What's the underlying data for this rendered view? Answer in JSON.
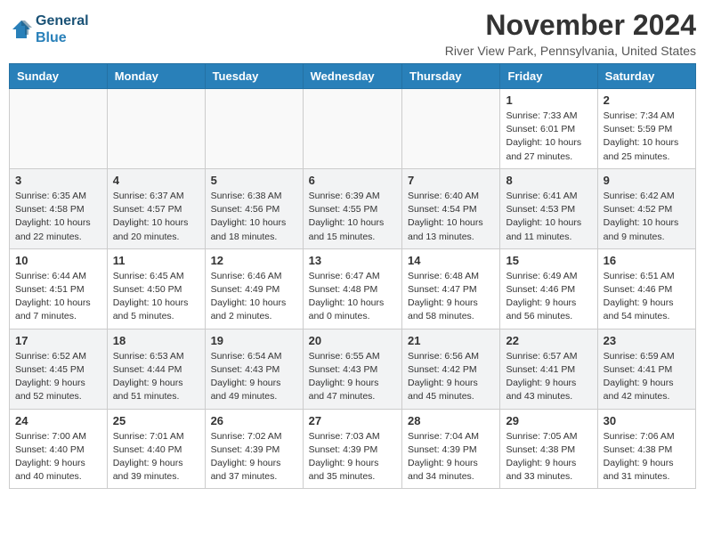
{
  "header": {
    "logo_line1": "General",
    "logo_line2": "Blue",
    "month_title": "November 2024",
    "location": "River View Park, Pennsylvania, United States"
  },
  "days_of_week": [
    "Sunday",
    "Monday",
    "Tuesday",
    "Wednesday",
    "Thursday",
    "Friday",
    "Saturday"
  ],
  "weeks": [
    [
      {
        "day": "",
        "info": ""
      },
      {
        "day": "",
        "info": ""
      },
      {
        "day": "",
        "info": ""
      },
      {
        "day": "",
        "info": ""
      },
      {
        "day": "",
        "info": ""
      },
      {
        "day": "1",
        "info": "Sunrise: 7:33 AM\nSunset: 6:01 PM\nDaylight: 10 hours and 27 minutes."
      },
      {
        "day": "2",
        "info": "Sunrise: 7:34 AM\nSunset: 5:59 PM\nDaylight: 10 hours and 25 minutes."
      }
    ],
    [
      {
        "day": "3",
        "info": "Sunrise: 6:35 AM\nSunset: 4:58 PM\nDaylight: 10 hours and 22 minutes."
      },
      {
        "day": "4",
        "info": "Sunrise: 6:37 AM\nSunset: 4:57 PM\nDaylight: 10 hours and 20 minutes."
      },
      {
        "day": "5",
        "info": "Sunrise: 6:38 AM\nSunset: 4:56 PM\nDaylight: 10 hours and 18 minutes."
      },
      {
        "day": "6",
        "info": "Sunrise: 6:39 AM\nSunset: 4:55 PM\nDaylight: 10 hours and 15 minutes."
      },
      {
        "day": "7",
        "info": "Sunrise: 6:40 AM\nSunset: 4:54 PM\nDaylight: 10 hours and 13 minutes."
      },
      {
        "day": "8",
        "info": "Sunrise: 6:41 AM\nSunset: 4:53 PM\nDaylight: 10 hours and 11 minutes."
      },
      {
        "day": "9",
        "info": "Sunrise: 6:42 AM\nSunset: 4:52 PM\nDaylight: 10 hours and 9 minutes."
      }
    ],
    [
      {
        "day": "10",
        "info": "Sunrise: 6:44 AM\nSunset: 4:51 PM\nDaylight: 10 hours and 7 minutes."
      },
      {
        "day": "11",
        "info": "Sunrise: 6:45 AM\nSunset: 4:50 PM\nDaylight: 10 hours and 5 minutes."
      },
      {
        "day": "12",
        "info": "Sunrise: 6:46 AM\nSunset: 4:49 PM\nDaylight: 10 hours and 2 minutes."
      },
      {
        "day": "13",
        "info": "Sunrise: 6:47 AM\nSunset: 4:48 PM\nDaylight: 10 hours and 0 minutes."
      },
      {
        "day": "14",
        "info": "Sunrise: 6:48 AM\nSunset: 4:47 PM\nDaylight: 9 hours and 58 minutes."
      },
      {
        "day": "15",
        "info": "Sunrise: 6:49 AM\nSunset: 4:46 PM\nDaylight: 9 hours and 56 minutes."
      },
      {
        "day": "16",
        "info": "Sunrise: 6:51 AM\nSunset: 4:46 PM\nDaylight: 9 hours and 54 minutes."
      }
    ],
    [
      {
        "day": "17",
        "info": "Sunrise: 6:52 AM\nSunset: 4:45 PM\nDaylight: 9 hours and 52 minutes."
      },
      {
        "day": "18",
        "info": "Sunrise: 6:53 AM\nSunset: 4:44 PM\nDaylight: 9 hours and 51 minutes."
      },
      {
        "day": "19",
        "info": "Sunrise: 6:54 AM\nSunset: 4:43 PM\nDaylight: 9 hours and 49 minutes."
      },
      {
        "day": "20",
        "info": "Sunrise: 6:55 AM\nSunset: 4:43 PM\nDaylight: 9 hours and 47 minutes."
      },
      {
        "day": "21",
        "info": "Sunrise: 6:56 AM\nSunset: 4:42 PM\nDaylight: 9 hours and 45 minutes."
      },
      {
        "day": "22",
        "info": "Sunrise: 6:57 AM\nSunset: 4:41 PM\nDaylight: 9 hours and 43 minutes."
      },
      {
        "day": "23",
        "info": "Sunrise: 6:59 AM\nSunset: 4:41 PM\nDaylight: 9 hours and 42 minutes."
      }
    ],
    [
      {
        "day": "24",
        "info": "Sunrise: 7:00 AM\nSunset: 4:40 PM\nDaylight: 9 hours and 40 minutes."
      },
      {
        "day": "25",
        "info": "Sunrise: 7:01 AM\nSunset: 4:40 PM\nDaylight: 9 hours and 39 minutes."
      },
      {
        "day": "26",
        "info": "Sunrise: 7:02 AM\nSunset: 4:39 PM\nDaylight: 9 hours and 37 minutes."
      },
      {
        "day": "27",
        "info": "Sunrise: 7:03 AM\nSunset: 4:39 PM\nDaylight: 9 hours and 35 minutes."
      },
      {
        "day": "28",
        "info": "Sunrise: 7:04 AM\nSunset: 4:39 PM\nDaylight: 9 hours and 34 minutes."
      },
      {
        "day": "29",
        "info": "Sunrise: 7:05 AM\nSunset: 4:38 PM\nDaylight: 9 hours and 33 minutes."
      },
      {
        "day": "30",
        "info": "Sunrise: 7:06 AM\nSunset: 4:38 PM\nDaylight: 9 hours and 31 minutes."
      }
    ]
  ]
}
